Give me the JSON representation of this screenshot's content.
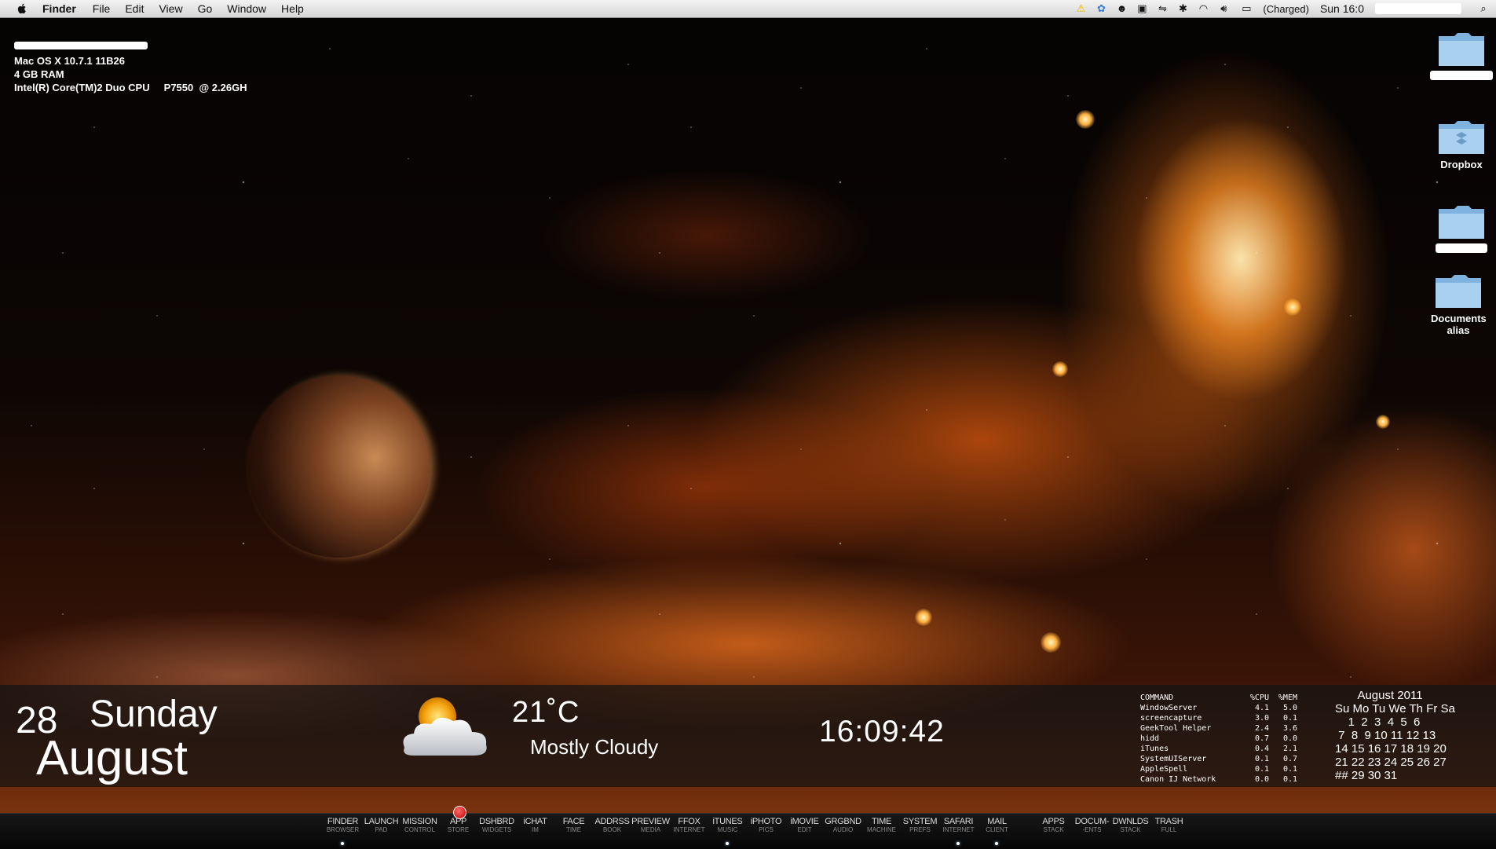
{
  "menubar": {
    "app_name": "Finder",
    "items": [
      "File",
      "Edit",
      "View",
      "Go",
      "Window",
      "Help"
    ],
    "battery_text": "(Charged)",
    "clock": "Sun 16:0"
  },
  "sysinfo": {
    "os": "Mac OS X 10.7.1 11B26",
    "ram": "4 GB RAM",
    "cpu": "Intel(R) Core(TM)2 Duo CPU     P7550  @ 2.26GH"
  },
  "desktop_icons": [
    {
      "label": ""
    },
    {
      "label": "Dropbox"
    },
    {
      "label": ""
    },
    {
      "label": "Documents alias"
    }
  ],
  "widgets": {
    "date_day": "28",
    "date_weekday": "Sunday",
    "date_month": "August",
    "temperature": "21˚C",
    "condition": "Mostly Cloudy",
    "time": "16:09:42",
    "process_table": {
      "headers": [
        "COMMAND",
        "%CPU",
        "%MEM"
      ],
      "rows": [
        [
          "WindowServer",
          "4.1",
          "5.0"
        ],
        [
          "screencapture",
          "3.0",
          "0.1"
        ],
        [
          "GeekTool Helper",
          "2.4",
          "3.6"
        ],
        [
          "hidd",
          "0.7",
          "0.0"
        ],
        [
          "iTunes",
          "0.4",
          "2.1"
        ],
        [
          "SystemUIServer",
          "0.1",
          "0.7"
        ],
        [
          "AppleSpell",
          "0.1",
          "0.1"
        ],
        [
          "Canon IJ Network",
          "0.0",
          "0.1"
        ]
      ]
    },
    "calendar": {
      "title": "August 2011",
      "lines": [
        "Su Mo Tu We Th Fr Sa",
        "    1  2  3  4  5  6",
        " 7  8  9 10 11 12 13",
        "14 15 16 17 18 19 20",
        "21 22 23 24 25 26 27",
        "## 29 30 31"
      ]
    }
  },
  "dock": {
    "items": [
      {
        "label": "FINDER",
        "sub": "BROWSER",
        "running": true
      },
      {
        "label": "LAUNCH",
        "sub": "PAD",
        "running": false
      },
      {
        "label": "MISSION",
        "sub": "CONTROL",
        "running": false
      },
      {
        "label": "APP",
        "sub": "STORE",
        "running": false,
        "badge": true
      },
      {
        "label": "DSHBRD",
        "sub": "WIDGETS",
        "running": false
      },
      {
        "label": "iCHAT",
        "sub": "IM",
        "running": false
      },
      {
        "label": "FACE",
        "sub": "TIME",
        "running": false
      },
      {
        "label": "ADDRSS",
        "sub": "BOOK",
        "running": false
      },
      {
        "label": "PREVIEW",
        "sub": "MEDIA",
        "running": false
      },
      {
        "label": "FFOX",
        "sub": "INTERNET",
        "running": false
      },
      {
        "label": "iTUNES",
        "sub": "MUSIC",
        "running": true
      },
      {
        "label": "iPHOTO",
        "sub": "PICS",
        "running": false
      },
      {
        "label": "iMOVIE",
        "sub": "EDIT",
        "running": false
      },
      {
        "label": "GRGBND",
        "sub": "AUDIO",
        "running": false
      },
      {
        "label": "TIME",
        "sub": "MACHINE",
        "running": false
      },
      {
        "label": "SYSTEM",
        "sub": "PREFS",
        "running": false
      },
      {
        "label": "SAFARI",
        "sub": "INTERNET",
        "running": true
      },
      {
        "label": "MAIL",
        "sub": "CLIENT",
        "running": true
      }
    ],
    "stacks": [
      {
        "label": "APPS",
        "sub": "STACK",
        "running": false
      },
      {
        "label": "DOCUM-",
        "sub": "-ENTS",
        "running": false
      },
      {
        "label": "DWNLDS",
        "sub": "STACK",
        "running": false
      },
      {
        "label": "TRASH",
        "sub": "FULL",
        "running": false
      }
    ]
  }
}
